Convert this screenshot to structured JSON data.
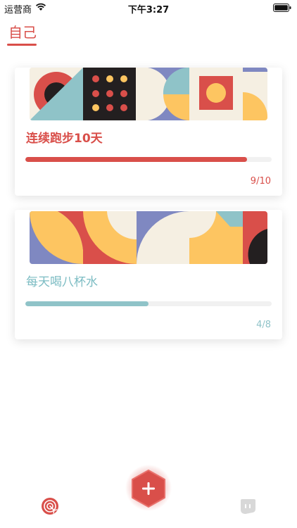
{
  "status_bar": {
    "carrier": "运营商",
    "time": "下午3:27"
  },
  "tabs": {
    "self": "自己"
  },
  "goals": [
    {
      "title": "连续跑步10天",
      "done": 9,
      "total": 10,
      "progress_label": "9/10",
      "progress_fraction": 0.9,
      "color": "#d94f4a"
    },
    {
      "title": "每天喝八杯水",
      "done": 4,
      "total": 8,
      "progress_label": "4/8",
      "progress_fraction": 0.5,
      "color": "#8fc3c8"
    }
  ],
  "icons": {
    "wifi": "wifi-icon",
    "battery": "battery-icon",
    "add": "plus-icon",
    "target": "target-icon",
    "chat": "chat-bubble-icon"
  },
  "palette": {
    "red": "#d94f4a",
    "teal": "#8fc3c8",
    "yellow": "#fdc561",
    "navy": "#7f88c1",
    "cream": "#f5efe2",
    "black": "#231f20"
  }
}
